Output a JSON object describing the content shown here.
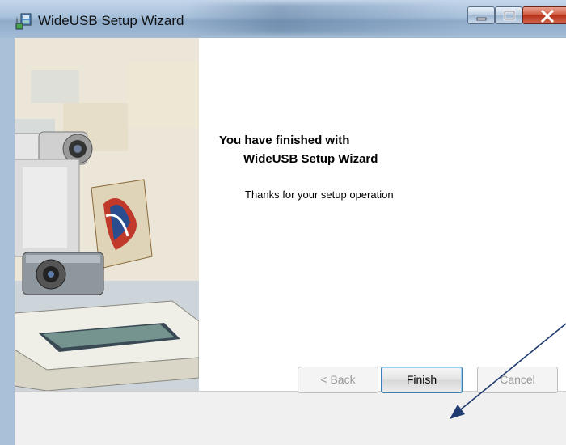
{
  "window": {
    "title": "WideUSB Setup Wizard",
    "app_icon": "setup-icon",
    "controls": {
      "minimize": "minimize-icon",
      "maximize": "maximize-icon",
      "close": "close-icon"
    }
  },
  "content": {
    "heading_line1": "You have finished with",
    "heading_line2": "WideUSB Setup Wizard",
    "body": "Thanks for your setup operation"
  },
  "buttons": {
    "back": "< Back",
    "finish": "Finish",
    "cancel": "Cancel"
  },
  "banner": {
    "image": "devices-illustration"
  },
  "annotation": {
    "arrow_color": "#1f3a6e"
  }
}
